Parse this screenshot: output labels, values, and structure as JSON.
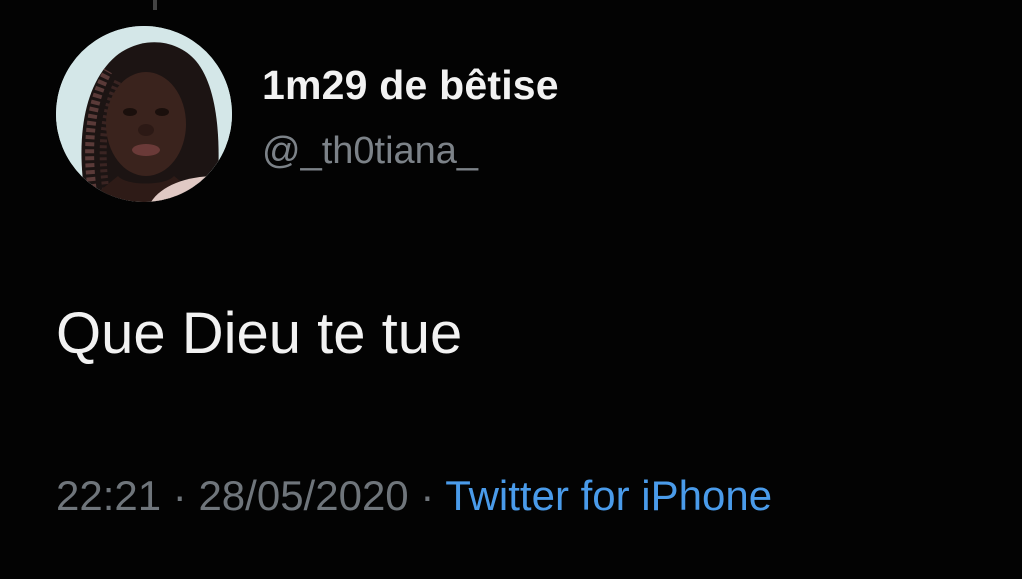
{
  "tweet": {
    "display_name": "1m29 de bêtise",
    "handle": "@_th0tiana_",
    "text": "Que Dieu te tue",
    "time": "22:21",
    "separator": "·",
    "date": "28/05/2020",
    "source": "Twitter for iPhone"
  },
  "avatar": {
    "icon": "profile-photo"
  },
  "colors": {
    "background": "#030303",
    "text": "#f2f2f2",
    "muted": "#7c8288",
    "link": "#4a9bea"
  }
}
